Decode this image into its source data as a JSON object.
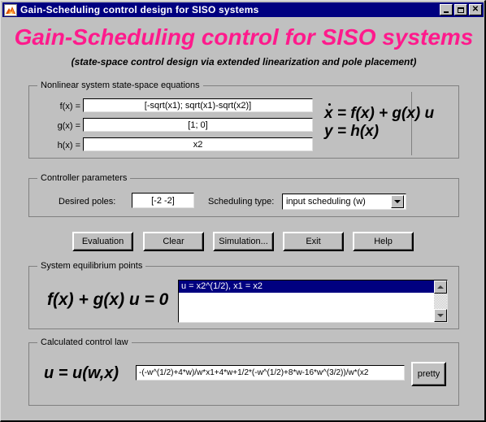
{
  "window": {
    "title": "Gain-Scheduling control design for SISO systems",
    "icon": "matlab-membrane-icon",
    "controls": {
      "minimize": "minimize",
      "maximize": "maximize",
      "close": "close"
    },
    "colors": {
      "titlebar": "#000080",
      "face": "#c0c0c0",
      "accent_title": "#ff1a8c",
      "selection": "#000080"
    }
  },
  "header": {
    "title": "Gain-Scheduling control for SISO systems",
    "subtitle": "(state-space control design via extended linearization and pole placement)"
  },
  "nonlinear_group": {
    "label": "Nonlinear system state-space equations",
    "rows": [
      {
        "label": "f(x) =",
        "value": "[-sqrt(x1); sqrt(x1)-sqrt(x2)]"
      },
      {
        "label": "g(x) =",
        "value": "[1; 0]"
      },
      {
        "label": "h(x) =",
        "value": "x2"
      }
    ],
    "equation_line1": "x = f(x) + g(x) u",
    "equation_line1_var": "x",
    "equation_line1_rest": " = f(x) + g(x) u",
    "equation_line2": "y = h(x)"
  },
  "controller_group": {
    "label": "Controller parameters",
    "desired_poles_label": "Desired poles:",
    "desired_poles_value": "[-2 -2]",
    "scheduling_type_label": "Scheduling type:",
    "scheduling_type_value": "input scheduling (w)"
  },
  "buttons": [
    {
      "name": "evaluation",
      "label": "Evaluation"
    },
    {
      "name": "clear",
      "label": "Clear"
    },
    {
      "name": "simulation",
      "label": "Simulation..."
    },
    {
      "name": "exit",
      "label": "Exit"
    },
    {
      "name": "help",
      "label": "Help"
    }
  ],
  "equilibrium_group": {
    "label": "System equilibrium points",
    "equation": "f(x) + g(x) u = 0",
    "items": [
      {
        "text": "u = x2^(1/2), x1 = x2",
        "selected": true
      }
    ]
  },
  "control_law_group": {
    "label": "Calculated control law",
    "equation": "u = u(w,x)",
    "value": "-(-w^(1/2)+4*w)/w*x1+4*w+1/2*(-w^(1/2)+8*w-16*w^(3/2))/w*(x2",
    "pretty_label": "pretty"
  }
}
